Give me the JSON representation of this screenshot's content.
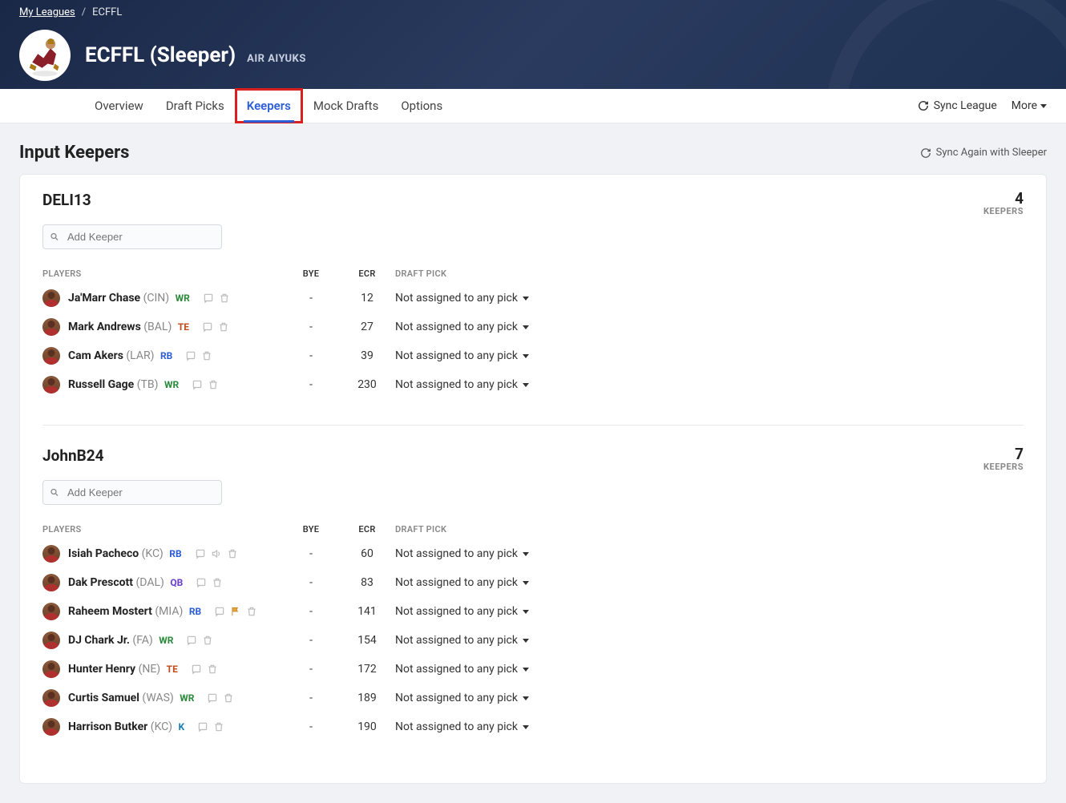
{
  "breadcrumb": {
    "root": "My Leagues",
    "current": "ECFFL"
  },
  "league": {
    "title": "ECFFL (Sleeper)",
    "subtitle": "AIR AIYUKS"
  },
  "tabs": {
    "overview": "Overview",
    "draft_picks": "Draft Picks",
    "keepers": "Keepers",
    "mock_drafts": "Mock Drafts",
    "options": "Options"
  },
  "actions": {
    "sync_league": "Sync League",
    "more": "More"
  },
  "page": {
    "title": "Input Keepers",
    "sync_again": "Sync Again with Sleeper"
  },
  "inputs": {
    "add_keeper_placeholder": "Add Keeper"
  },
  "headers": {
    "players": "PLAYERS",
    "bye": "BYE",
    "ecr": "ECR",
    "draft_pick": "DRAFT PICK"
  },
  "keepers_label": "KEEPERS",
  "draft_unassigned": "Not assigned to any pick",
  "teams": [
    {
      "name": "DELI13",
      "keeper_count": "4",
      "players": [
        {
          "name": "Ja'Marr Chase",
          "team": "(CIN)",
          "pos": "WR",
          "bye": "-",
          "ecr": "12",
          "draft": "Not assigned to any pick"
        },
        {
          "name": "Mark Andrews",
          "team": "(BAL)",
          "pos": "TE",
          "bye": "-",
          "ecr": "27",
          "draft": "Not assigned to any pick"
        },
        {
          "name": "Cam Akers",
          "team": "(LAR)",
          "pos": "RB",
          "bye": "-",
          "ecr": "39",
          "draft": "Not assigned to any pick"
        },
        {
          "name": "Russell Gage",
          "team": "(TB)",
          "pos": "WR",
          "bye": "-",
          "ecr": "230",
          "draft": "Not assigned to any pick"
        }
      ]
    },
    {
      "name": "JohnB24",
      "keeper_count": "7",
      "players": [
        {
          "name": "Isiah Pacheco",
          "team": "(KC)",
          "pos": "RB",
          "bye": "-",
          "ecr": "60",
          "draft": "Not assigned to any pick",
          "sound": true
        },
        {
          "name": "Dak Prescott",
          "team": "(DAL)",
          "pos": "QB",
          "bye": "-",
          "ecr": "83",
          "draft": "Not assigned to any pick"
        },
        {
          "name": "Raheem Mostert",
          "team": "(MIA)",
          "pos": "RB",
          "bye": "-",
          "ecr": "141",
          "draft": "Not assigned to any pick",
          "flag": true
        },
        {
          "name": "DJ Chark Jr.",
          "team": "(FA)",
          "pos": "WR",
          "bye": "-",
          "ecr": "154",
          "draft": "Not assigned to any pick"
        },
        {
          "name": "Hunter Henry",
          "team": "(NE)",
          "pos": "TE",
          "bye": "-",
          "ecr": "172",
          "draft": "Not assigned to any pick"
        },
        {
          "name": "Curtis Samuel",
          "team": "(WAS)",
          "pos": "WR",
          "bye": "-",
          "ecr": "189",
          "draft": "Not assigned to any pick"
        },
        {
          "name": "Harrison Butker",
          "team": "(KC)",
          "pos": "K",
          "bye": "-",
          "ecr": "190",
          "draft": "Not assigned to any pick"
        }
      ]
    }
  ]
}
